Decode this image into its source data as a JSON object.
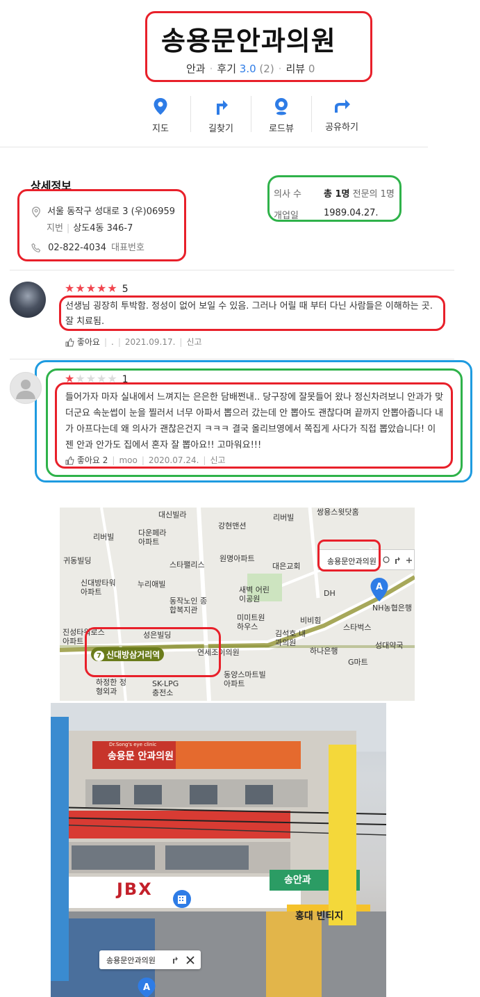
{
  "header": {
    "title": "송용문안과의원",
    "category": "안과",
    "reviews_label": "후기",
    "rating": "3.0",
    "review_count": "(2)",
    "blog_label": "리뷰",
    "blog_count": "0"
  },
  "actions": [
    {
      "label": "지도",
      "icon": "map-pin-icon"
    },
    {
      "label": "길찾기",
      "icon": "directions-icon"
    },
    {
      "label": "로드뷰",
      "icon": "roadview-icon"
    },
    {
      "label": "공유하기",
      "icon": "share-icon"
    }
  ],
  "details": {
    "heading": "상세정보",
    "address": "서울 동작구 성대로 3 (우)06959",
    "lot_label": "지번",
    "lot_address": "상도4동 346-7",
    "phone": "02-822-4034",
    "phone_label": "대표번호",
    "doctors_label": "의사 수",
    "doctors_total": "총 1명",
    "doctors_specialist": "전문의 1명",
    "opened_label": "개업일",
    "opened_date": "1989.04.27."
  },
  "reviews": [
    {
      "rating": "5",
      "stars": 5,
      "text": "선생님 굉장히 투박함. 정성이 없어 보일 수 있음. 그러나 어릴 때 부터 다닌 사람들은 이해하는 곳. 잘 치료됨.",
      "like_label": "좋아요",
      "author": ".",
      "date": "2021.09.17.",
      "report_label": "신고"
    },
    {
      "rating": "1",
      "stars": 1,
      "text": "들어가자 마자 실내에서 느껴지는 은은한 담배쩐내.. 당구장에 잘못들어 왔나 정신차려보니 안과가 맞더군요 속눈썹이 눈을 찔러서 너무 아파서 뽑으러 갔는데 안 뽑아도 괜찮다며 끝까지 안뽑아줍니다 내가 아프다는데 왜 의사가 괜찮은건지 ㅋㅋㅋ 결국 올리브영에서 쪽집게 사다가 직접 뽑았습니다! 이젠 안과 안가도 집에서 혼자 잘 뽑아요!! 고마워요!!!",
      "like_label": "좋아요 2",
      "author": "moo",
      "date": "2020.07.24.",
      "report_label": "신고"
    }
  ],
  "map": {
    "card_label": "송용문안과의원",
    "marker_letter": "A",
    "station_number": "7",
    "station_name": "신대방삼거리역",
    "labels": {
      "daesin": "대신빌라",
      "gangheon": "강현맨션",
      "riverbill": "리버빌",
      "riverbill2": "리버빌",
      "ssangyong": "쌍용스윗닷홈",
      "apt": "아파트",
      "daun": "다운페라 아파트",
      "gwidong": "귀동빌딩",
      "star": "스타팰리스",
      "wonmyeong": "원명아파트",
      "daeeun": "대은교회",
      "sindaebang": "신대방타워 아파트",
      "nuri": "누리애빌",
      "saebyeok": "새벽 어린이공원",
      "dongjak": "동작노인 종합복지관",
      "dh": "DH",
      "nh": "NH농협은행",
      "jinsung": "진성타워로스 아파트",
      "sungeun": "성은빌딩",
      "mimi": "미미트원 하우스",
      "bibim": "비비힘",
      "kimseok": "김석호 내과의원",
      "starbucks": "스타벅스",
      "sungdae": "성대약국",
      "hana": "하나은행",
      "gmart": "G마트",
      "yeonse": "연세조이의원",
      "dongyang": "동양스마트빌 아파트",
      "hajeong": "하정한 정형외과",
      "sklpg": "SK-LPG 충전소"
    }
  },
  "photo": {
    "card_label": "송용문안과의원",
    "marker_letter": "A",
    "sign_main": "송용문 안과의원",
    "sign_sub": "Dr.Song's eye clinic",
    "store_sign": "홍대 빈티지",
    "store_sign2": "송안과",
    "shop_sign": "JBX"
  }
}
